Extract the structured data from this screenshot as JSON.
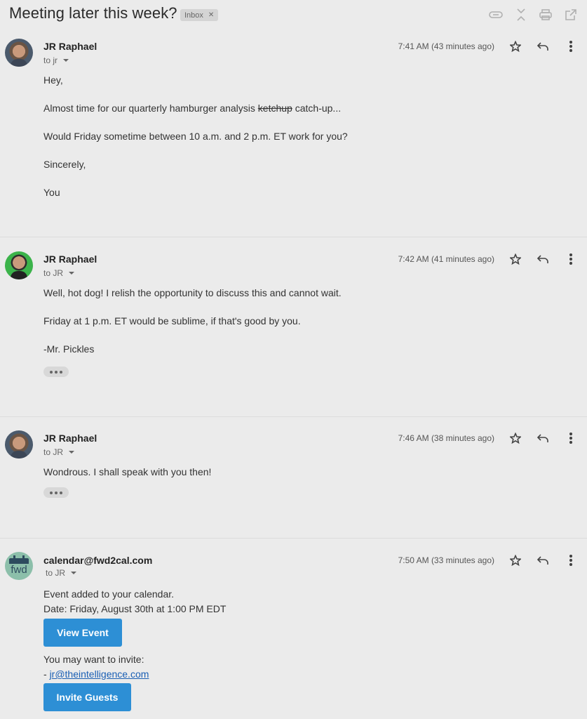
{
  "thread": {
    "subject": "Meeting later this week?",
    "label": "Inbox",
    "toolbar_icons": [
      "link-icon",
      "collapse-icon",
      "print-icon",
      "open-external-icon"
    ]
  },
  "messages": [
    {
      "sender": "JR Raphael",
      "to": "to jr",
      "time": "7:41 AM (43 minutes ago)",
      "body": {
        "greeting": "Hey,",
        "line1_before": "Almost time for our quarterly hamburger analysis ",
        "line1_strike": "ketchup",
        "line1_after": " catch-up...",
        "line2": "Would Friday sometime between 10 a.m. and 2 p.m. ET work for you?",
        "closing": "Sincerely,",
        "signature": "You"
      }
    },
    {
      "sender": "JR Raphael",
      "to": "to JR",
      "time": "7:42 AM (41 minutes ago)",
      "body": {
        "line1": "Well, hot dog! I relish the opportunity to discuss this and cannot wait.",
        "line2": "Friday at 1 p.m. ET would be sublime, if that's good by you.",
        "signature": "-Mr. Pickles"
      }
    },
    {
      "sender": "JR Raphael",
      "to": "to JR",
      "time": "7:46 AM (38 minutes ago)",
      "body": {
        "line1": "Wondrous. I shall speak with you then!"
      }
    },
    {
      "sender": "calendar@fwd2cal.com",
      "avatar_text": "fwd",
      "to": "to JR",
      "time": "7:50 AM (33 minutes ago)",
      "body": {
        "line1": "Event added to your calendar.",
        "line2": "Date: Friday, August 30th at 1:00 PM EDT",
        "view_button": "View Event",
        "invite_prompt": "You may want to invite:",
        "invite_prefix": "- ",
        "invite_email": "jr@theintelligence.com",
        "invite_button": "Invite Guests"
      }
    }
  ],
  "colors": {
    "background": "#ebebeb",
    "button": "#2d8fd5",
    "link": "#1a5fb4"
  }
}
